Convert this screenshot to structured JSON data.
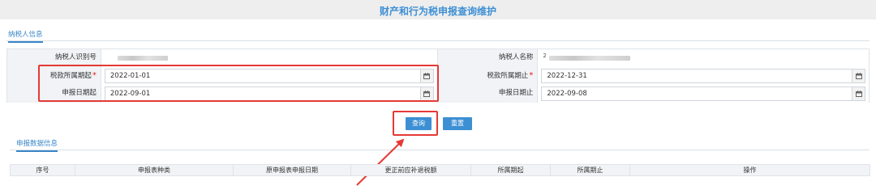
{
  "page": {
    "title": "财产和行为税申报查询维护"
  },
  "taxpayer_tab": {
    "label": "纳税人信息"
  },
  "form": {
    "taxpayer_id_label": "纳税人识别号",
    "taxpayer_name_label": "纳税人名称",
    "taxpayer_name_prefix": "2",
    "period_start_label": "税款所属期起",
    "period_start_value": "2022-01-01",
    "period_end_label": "税款所属期止",
    "period_end_value": "2022-12-31",
    "filing_start_label": "申报日期起",
    "filing_start_value": "2022-09-01",
    "filing_end_label": "申报日期止",
    "filing_end_value": "2022-09-08",
    "required_mark": "*"
  },
  "buttons": {
    "query": "查询",
    "reset": "重置"
  },
  "data_tab": {
    "label": "申报数据信息"
  },
  "table": {
    "columns": [
      "序号",
      "申报表种类",
      "原申报表申报日期",
      "更正前应补退税额",
      "所属期起",
      "所属期止",
      "操作"
    ]
  },
  "colors": {
    "accent": "#3d8fd4",
    "highlight": "#e53935",
    "required": "#e02020"
  }
}
